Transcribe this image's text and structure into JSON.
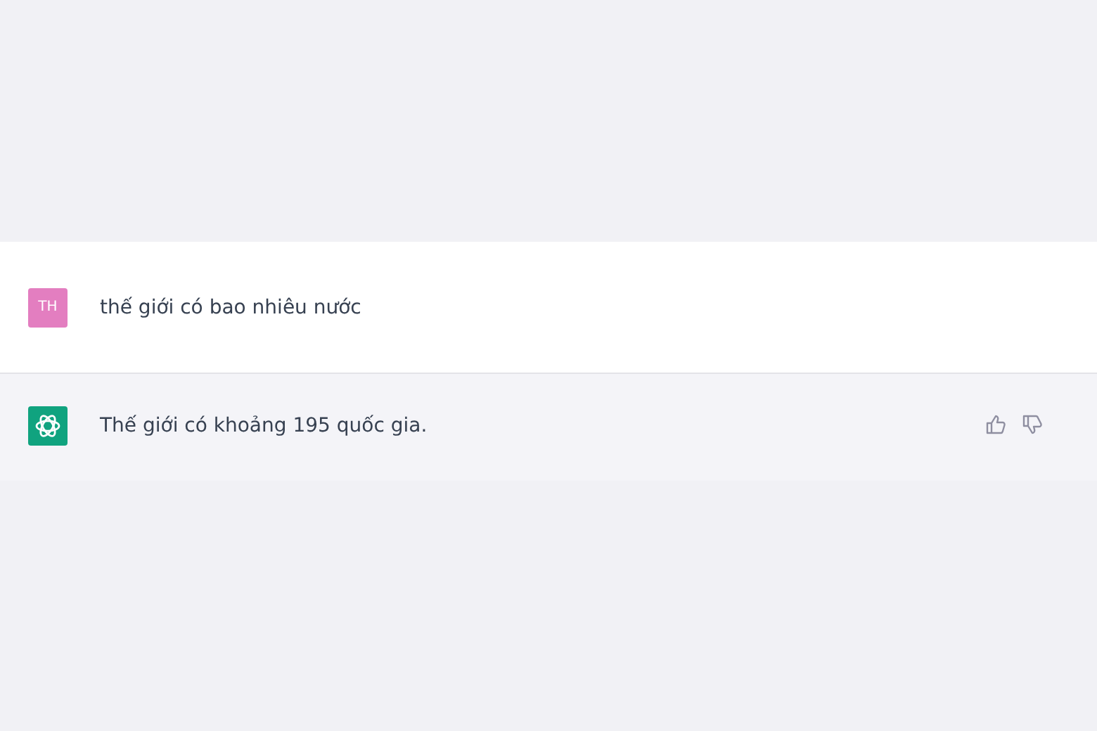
{
  "messages": [
    {
      "kind": "user",
      "avatar": "TH",
      "text": "thế giới có bao nhiêu nước"
    },
    {
      "kind": "assistant",
      "text": "Thế giới có khoảng 195 quốc gia."
    }
  ]
}
